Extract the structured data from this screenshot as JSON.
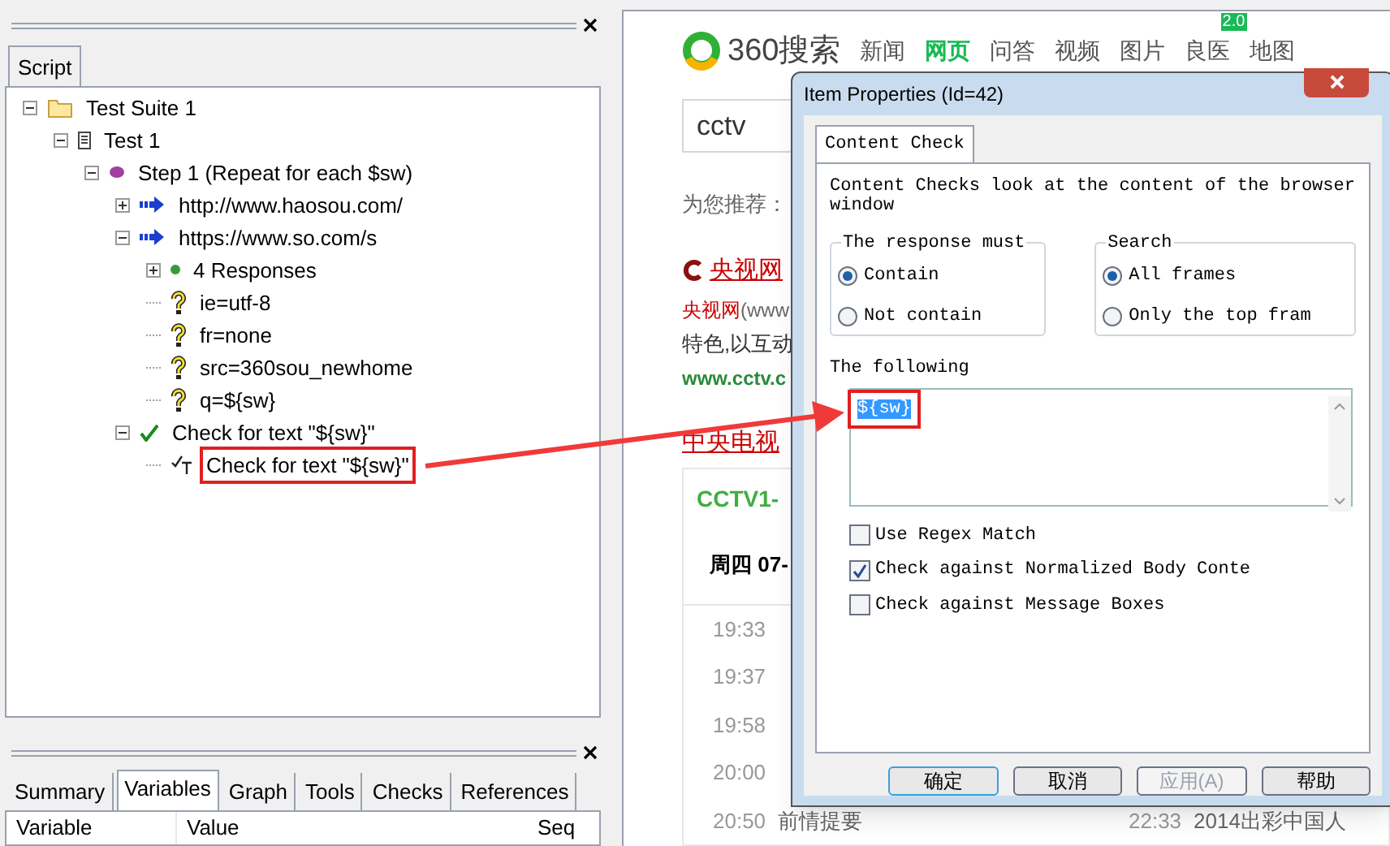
{
  "script_panel": {
    "tabs": [
      {
        "label": "Script",
        "selected": true
      }
    ],
    "tree": [
      {
        "label": "Test Suite 1",
        "kind": "folder",
        "expanded": true,
        "children": [
          {
            "label": "Test 1",
            "kind": "test",
            "expanded": true,
            "children": [
              {
                "label": "Step 1 (Repeat for each $sw)",
                "kind": "step",
                "expanded": true,
                "children": [
                  {
                    "label": "http://www.haosou.com/",
                    "kind": "request",
                    "expanded": false
                  },
                  {
                    "label": "https://www.so.com/s",
                    "kind": "request",
                    "expanded": true,
                    "children": [
                      {
                        "label": "4 Responses",
                        "kind": "responses",
                        "expanded": false
                      },
                      {
                        "label": "ie=utf-8",
                        "kind": "param"
                      },
                      {
                        "label": "fr=none",
                        "kind": "param"
                      },
                      {
                        "label": "src=360sou_newhome",
                        "kind": "param"
                      },
                      {
                        "label": "q=${sw}",
                        "kind": "param"
                      }
                    ]
                  },
                  {
                    "label": "Check for text \"${sw}\"",
                    "kind": "check",
                    "expanded": true,
                    "children": [
                      {
                        "label": "Check for text \"${sw}\"",
                        "kind": "textcheck",
                        "highlighted": true
                      }
                    ]
                  }
                ]
              }
            ]
          }
        ]
      }
    ]
  },
  "bottom_panel": {
    "tabs": [
      {
        "label": "Summary",
        "selected": false
      },
      {
        "label": "Variables",
        "selected": true
      },
      {
        "label": "Graph",
        "selected": false
      },
      {
        "label": "Tools",
        "selected": false
      },
      {
        "label": "Checks",
        "selected": false
      },
      {
        "label": "References",
        "selected": false
      }
    ],
    "columns": [
      "Variable",
      "Value",
      "Seq"
    ]
  },
  "browser": {
    "logo_text": "360搜索",
    "nav": [
      {
        "label": "新闻",
        "selected": false
      },
      {
        "label": "网页",
        "selected": true
      },
      {
        "label": "问答",
        "selected": false
      },
      {
        "label": "视频",
        "selected": false
      },
      {
        "label": "图片",
        "selected": false
      },
      {
        "label": "良医",
        "selected": false,
        "badge": "2.0"
      },
      {
        "label": "地图",
        "selected": false
      }
    ],
    "search_value": "cctv",
    "recommend": "为您推荐：",
    "result_title": "央视网",
    "snippet": [
      {
        "text": "央视网",
        "kind": "highlight"
      },
      {
        "text": "(www",
        "kind": "plain"
      }
    ],
    "snippet_line2": "特色,以互动",
    "result_url": "www.cctv.c",
    "result2_title": "中央电视",
    "card": {
      "title": "CCTV1-",
      "date": "周四 07-",
      "rows": [
        {
          "time": "19:33"
        },
        {
          "time": "19:37"
        },
        {
          "time": "19:58"
        },
        {
          "time": "20:00"
        },
        {
          "time": "20:50",
          "title": "前情提要",
          "time2": "22:33",
          "title2": "2014出彩中国人"
        }
      ]
    }
  },
  "dialog": {
    "title": "Item Properties (Id=42)",
    "tabs": [
      {
        "label": "Content Check",
        "selected": true
      }
    ],
    "description": "Content Checks look at the content of the browser window",
    "groups": [
      {
        "title": "The response must",
        "options": [
          {
            "label": "Contain",
            "selected": true
          },
          {
            "label": "Not contain",
            "selected": false
          }
        ]
      },
      {
        "title": "Search",
        "options": [
          {
            "label": "All frames",
            "selected": true
          },
          {
            "label": "Only the top fram",
            "selected": false
          }
        ]
      }
    ],
    "following_label": "The following",
    "following_value": "${sw}",
    "following_highlighted": true,
    "checkboxes": [
      {
        "label": "Use Regex Match",
        "checked": false
      },
      {
        "label": "Check against Normalized Body Conte",
        "checked": true
      },
      {
        "label": "Check against Message Boxes",
        "checked": false
      }
    ],
    "buttons": [
      {
        "label": "确定",
        "default": true,
        "disabled": false
      },
      {
        "label": "取消",
        "default": false,
        "disabled": false
      },
      {
        "label": "应用(A)",
        "default": false,
        "disabled": true
      },
      {
        "label": "帮助",
        "default": false,
        "disabled": false
      }
    ]
  }
}
